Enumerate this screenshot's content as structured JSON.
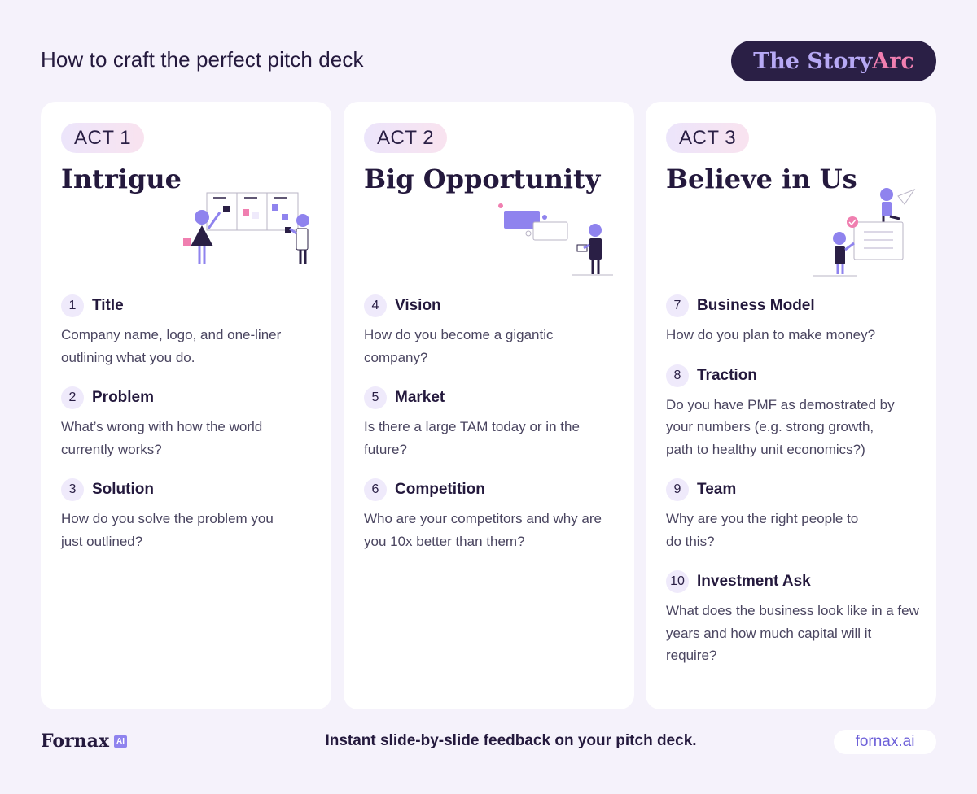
{
  "header": {
    "title": "How to craft the perfect pitch deck",
    "badge_part1": "The Story ",
    "badge_part2": "Arc"
  },
  "acts": [
    {
      "label": "ACT 1",
      "title": "Intrigue",
      "items": [
        {
          "num": "1",
          "name": "Title",
          "desc": "Company name, logo, and one-liner outlining what you do."
        },
        {
          "num": "2",
          "name": "Problem",
          "desc": "What’s wrong with how the world currently works?"
        },
        {
          "num": "3",
          "name": "Solution",
          "desc": "How do you solve the problem you just outlined?"
        }
      ]
    },
    {
      "label": "ACT 2",
      "title": "Big Opportunity",
      "items": [
        {
          "num": "4",
          "name": "Vision",
          "desc": "How do you become a gigantic company?"
        },
        {
          "num": "5",
          "name": "Market",
          "desc": "Is there a large TAM today or in the future?"
        },
        {
          "num": "6",
          "name": "Competition",
          "desc": "Who are your competitors and why are you 10x better than them?"
        }
      ]
    },
    {
      "label": "ACT 3",
      "title": "Believe in Us",
      "items": [
        {
          "num": "7",
          "name": "Business Model",
          "desc": "How do you plan to make money?"
        },
        {
          "num": "8",
          "name": "Traction",
          "desc": "Do you have PMF as demostrated by your numbers (e.g. strong growth, path to healthy unit economics?)"
        },
        {
          "num": "9",
          "name": "Team",
          "desc": "Why are you the right people to do this?"
        },
        {
          "num": "10",
          "name": "Investment Ask",
          "desc": "What does the business look like in a few years and how much capital will it require?"
        }
      ]
    }
  ],
  "footer": {
    "logo": "Fornax",
    "logo_badge": "AI",
    "tagline": "Instant slide-by-slide feedback on your pitch deck.",
    "url": "fornax.ai"
  },
  "colors": {
    "background": "#f5f2fb",
    "dark": "#24193d",
    "accent": "#8f83ee",
    "pink": "#f07fb0"
  }
}
